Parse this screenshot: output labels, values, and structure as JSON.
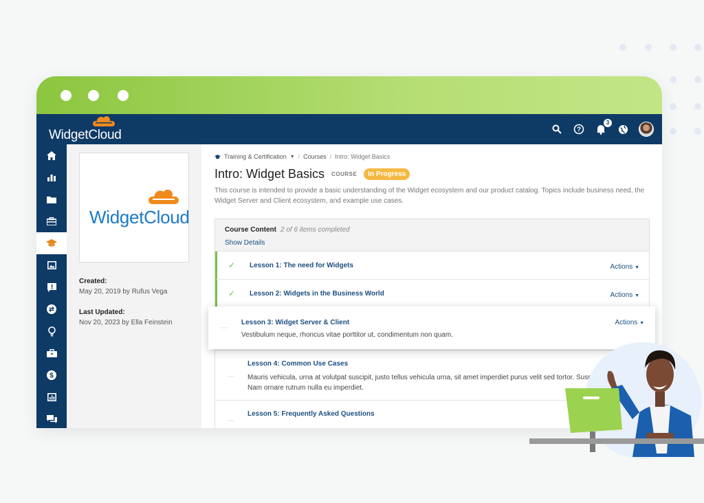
{
  "brand": {
    "name": "WidgetCloud",
    "accent": "#1b79c8",
    "nav_color": "#0e3a66",
    "chrome_green": "#8cc63f",
    "cloud_orange": "#f08a1c"
  },
  "topbar": {
    "icons": [
      "search-icon",
      "help-icon",
      "bell-icon",
      "globe-icon",
      "avatar"
    ],
    "notifications_count": "3"
  },
  "sidenav": {
    "items": [
      "home-icon",
      "bar-chart-icon",
      "folder-icon",
      "toolbox-icon",
      "graduation-cap-icon",
      "image-icon",
      "alert-icon",
      "swap-icon",
      "lightbulb-icon",
      "briefcase-icon",
      "dollar-icon",
      "report-icon",
      "chat-icon"
    ],
    "active_index": 4
  },
  "left_panel": {
    "created_label": "Created:",
    "created_value": "May 20, 2019 by Rufus Vega",
    "updated_label": "Last Updated:",
    "updated_value": "Nov 20, 2023 by Ella Feinstein"
  },
  "breadcrumb": {
    "root": "Training & Certification",
    "middle": "Courses",
    "current": "Intro: Widget Basics"
  },
  "course": {
    "title": "Intro: Widget Basics",
    "tag": "COURSE",
    "status": "In Progress",
    "description": "This course is intended to provide a basic understanding of the Widget ecosystem and our product catalog. Topics include business need, the Widget Server and Client ecosystem, and example use cases."
  },
  "content": {
    "heading": "Course Content",
    "progress": "2 of 6 items completed",
    "show_details": "Show Details",
    "actions_label": "Actions",
    "lessons": [
      {
        "title": "Lesson 1: The need for Widgets",
        "completed": true
      },
      {
        "title": "Lesson 2: Widgets in the Business World",
        "completed": true
      },
      {
        "title": "Lesson 3: Widget Server & Client",
        "description": "Vestibulum neque, rhoncus vitae porttitor ut, condimentum non quam.",
        "completed": false
      },
      {
        "title": "Lesson 4: Common Use Cases",
        "description": "Mauris vehicula, urna at volutpat suscipit, justo tellus vehicula urna, sit amet imperdiet purus velit sed tortor. Suspe libero. Nam ornare rutrum nulla eu imperdiet.",
        "completed": false
      },
      {
        "title": "Lesson 5: Frequently Asked Questions",
        "completed": false
      }
    ]
  }
}
